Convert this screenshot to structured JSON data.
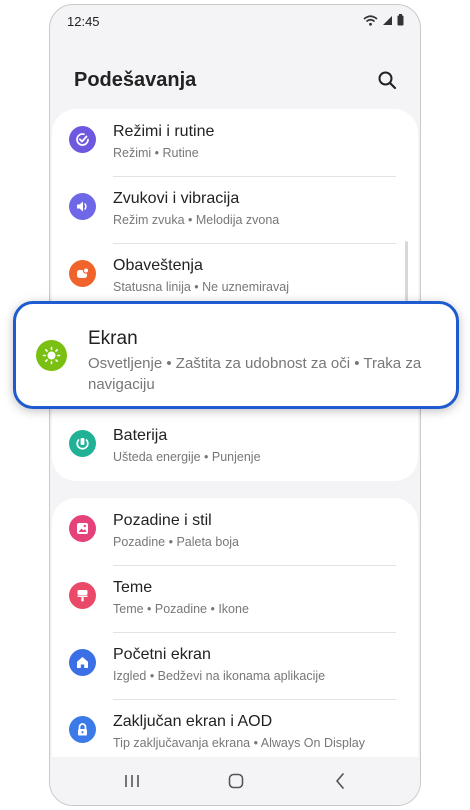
{
  "status": {
    "time": "12:45"
  },
  "header": {
    "title": "Podešavanja"
  },
  "items": [
    {
      "title": "Režimi i rutine",
      "subtitle": "Režimi • Rutine",
      "icon": "check-circle-icon",
      "color": "#6e58e0"
    },
    {
      "title": "Zvukovi i vibracija",
      "subtitle": "Režim zvuka • Melodija zvona",
      "icon": "speaker-icon",
      "color": "#6e68e8"
    },
    {
      "title": "Obaveštenja",
      "subtitle": "Statusna linija • Ne uznemiravaj",
      "icon": "notification-icon",
      "color": "#f0642b"
    },
    {
      "title": "Baterija",
      "subtitle": "Ušteda energije • Punjenje",
      "icon": "battery-icon",
      "color": "#21b296"
    },
    {
      "title": "Pozadine i stil",
      "subtitle": "Pozadine • Paleta boja",
      "icon": "image-icon",
      "color": "#e5417a"
    },
    {
      "title": "Teme",
      "subtitle": "Teme • Pozadine • Ikone",
      "icon": "brush-icon",
      "color": "#ea4a68"
    },
    {
      "title": "Početni ekran",
      "subtitle": "Izgled • Bedževi na ikonama aplikacije",
      "icon": "home-icon",
      "color": "#3b6fe6"
    },
    {
      "title": "Zaključan ekran i AOD",
      "subtitle": "Tip zaključavanja ekrana • Always On Display",
      "icon": "lock-icon",
      "color": "#3b7ae8"
    }
  ],
  "highlighted": {
    "title": "Ekran",
    "subtitle": "Osvetljenje  •  Zaštita za udobnost za oči  •  Traka za navigaciju",
    "icon": "sun-icon",
    "color": "#7ac013",
    "border_color": "#1e5bd1"
  }
}
